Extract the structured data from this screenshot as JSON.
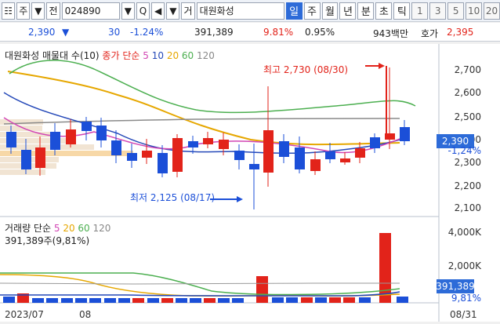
{
  "toolbar": {
    "left_buttons": [
      "주",
      "▼",
      "전"
    ],
    "code": "024890",
    "icons": [
      "▼",
      "Q",
      "◀",
      "▼"
    ],
    "name_prefix": "거",
    "name": "대원화성",
    "periods": [
      "일",
      "주",
      "월",
      "년",
      "분",
      "초",
      "틱"
    ],
    "numbers": [
      "1",
      "3",
      "5",
      "10",
      "20"
    ]
  },
  "quote": {
    "price": "2,390",
    "change_arrow": "▼",
    "change": "30",
    "change_pct": "-1.24%",
    "volume": "391,389",
    "volume_pct": "9.81%",
    "turnover_pct": "0.95%",
    "trade_value": "943백만",
    "bid_label": "호가",
    "bid_price": "2,395"
  },
  "chart_legend": {
    "main": "대원화성 매물대 수(10)",
    "ma_label": "종가 단순",
    "ma_5": "5",
    "ma_10": "10",
    "ma_20": "20",
    "ma_60": "60",
    "ma_120": "120",
    "volume_label": "거래량 단순",
    "volume_ma_5": "5",
    "volume_ma_20": "20",
    "volume_ma_60": "60",
    "volume_ma_120": "120",
    "volume_value": "391,389주(9,81%)"
  },
  "annotations": {
    "high": "최고 2,730 (08/30)",
    "low": "최저 2,125 (08/17)"
  },
  "axes": {
    "price_ticks": [
      "2,700",
      "2,600",
      "2,500",
      "2,400",
      "2,300",
      "2,200",
      "2,100"
    ],
    "price_box": "2,390",
    "price_change": "-1,24%",
    "volume_ticks": [
      "4,000K",
      "2,000K"
    ],
    "volume_box": "391,389",
    "volume_pct": "9,81%",
    "dates": [
      "2023/07",
      "08",
      "08/31"
    ]
  }
}
